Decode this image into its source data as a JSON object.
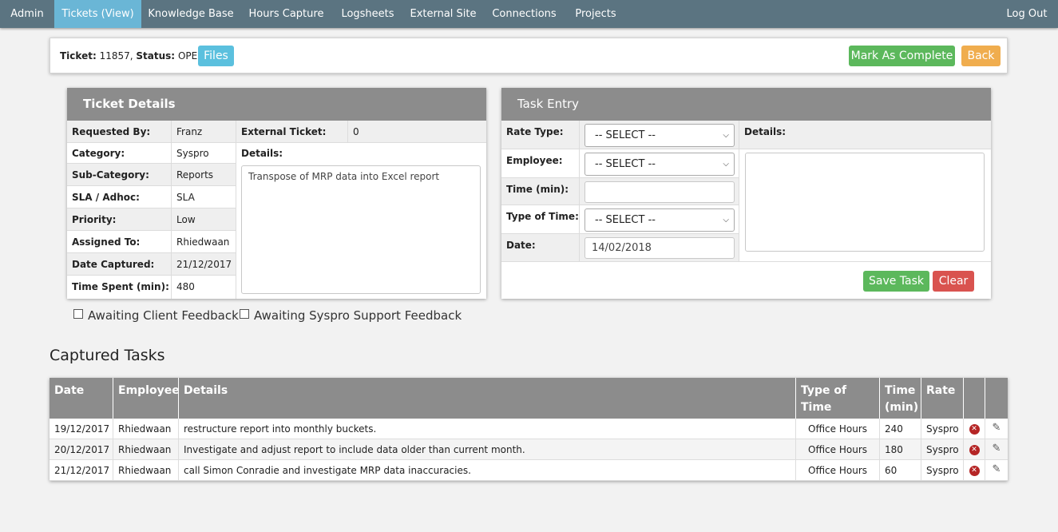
{
  "nav": {
    "items": [
      "Admin",
      "Tickets (View)",
      "Knowledge Base",
      "Hours Capture",
      "Logsheets",
      "External Site",
      "Connections",
      "Projects"
    ],
    "logout": "Log Out"
  },
  "ticket_bar": {
    "ticket_label": "Ticket:",
    "ticket_number": "11857,",
    "status_label": "Status:",
    "status_value": "OPEN",
    "files_button": "Files",
    "complete_button": "Mark As Complete",
    "back_button": "Back"
  },
  "ticket_details": {
    "title": "Ticket Details",
    "fields": [
      {
        "label": "Requested By:",
        "value": "Franz"
      },
      {
        "label": "Category:",
        "value": "Syspro"
      },
      {
        "label": "Sub-Category:",
        "value": "Reports"
      },
      {
        "label": "SLA / Adhoc:",
        "value": "SLA"
      },
      {
        "label": "Priority:",
        "value": "Low"
      },
      {
        "label": "Assigned To:",
        "value": "Rhiedwaan"
      },
      {
        "label": "Date Captured:",
        "value": "21/12/2017"
      },
      {
        "label": "Time Spent (min):",
        "value": "480"
      }
    ],
    "external_label": "External Ticket:",
    "external_value": "0",
    "details_label": "Details:",
    "details_text": "Transpose of MRP data into Excel report"
  },
  "task_entry": {
    "title": "Task Entry",
    "rate_type_label": "Rate Type:",
    "rate_type_value": "-- SELECT --",
    "employee_label": "Employee:",
    "employee_value": "-- SELECT --",
    "time_label": "Time (min):",
    "time_value": "",
    "type_of_time_label": "Type of Time:",
    "type_of_time_value": "-- SELECT --",
    "date_label": "Date:",
    "date_value": "14/02/2018",
    "details_label": "Details:",
    "details_value": "",
    "save_button": "Save Task",
    "clear_button": "Clear"
  },
  "feedback": {
    "client": "Awaiting Client Feedback",
    "syspro": "Awaiting Syspro Support Feedback"
  },
  "captured_tasks": {
    "title": "Captured Tasks",
    "headers": [
      "Date",
      "Employee",
      "Details",
      "Type of Time",
      "Time (min)",
      "Rate",
      "",
      ""
    ],
    "rows": [
      {
        "date": "19/12/2017",
        "employee": "Rhiedwaan",
        "details": "restructure report into monthly buckets.",
        "type": "Office Hours",
        "time": "240",
        "rate": "Syspro"
      },
      {
        "date": "20/12/2017",
        "employee": "Rhiedwaan",
        "details": "Investigate and adjust report to include data older than current month.",
        "type": "Office Hours",
        "time": "180",
        "rate": "Syspro"
      },
      {
        "date": "21/12/2017",
        "employee": "Rhiedwaan",
        "details": "call Simon Conradie and investigate MRP data inaccuracies.",
        "type": "Office Hours",
        "time": "60",
        "rate": "Syspro"
      }
    ]
  },
  "icons": {
    "delete": "delete-circle-icon",
    "edit": "pencil-icon"
  },
  "colors": {
    "navbar": "#5b7481",
    "nav_active": "#6ab6d6",
    "success": "#5cb85c",
    "warning": "#f0ad4e",
    "danger": "#d9534f",
    "info": "#5bc0de",
    "panel_header": "#8c8c8c"
  }
}
